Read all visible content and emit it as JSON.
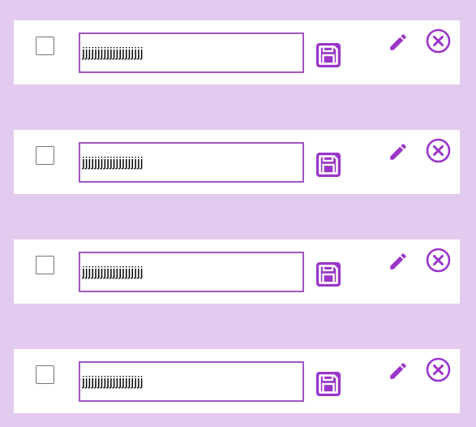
{
  "accent_color": "#9b35c9",
  "border_color": "#a156c0",
  "background_color": "#e3cbef",
  "icons": {
    "save": "floppy-disk-icon",
    "edit": "pencil-icon",
    "delete": "circle-x-icon"
  },
  "todos": [
    {
      "text": "jjjjjjjjjjjjjjjjjjjj",
      "checked": false
    },
    {
      "text": "jjjjjjjjjjjjjjjjjjjj",
      "checked": false
    },
    {
      "text": "jjjjjjjjjjjjjjjjjjjj",
      "checked": false
    },
    {
      "text": "jjjjjjjjjjjjjjjjjjjj",
      "checked": false
    }
  ]
}
